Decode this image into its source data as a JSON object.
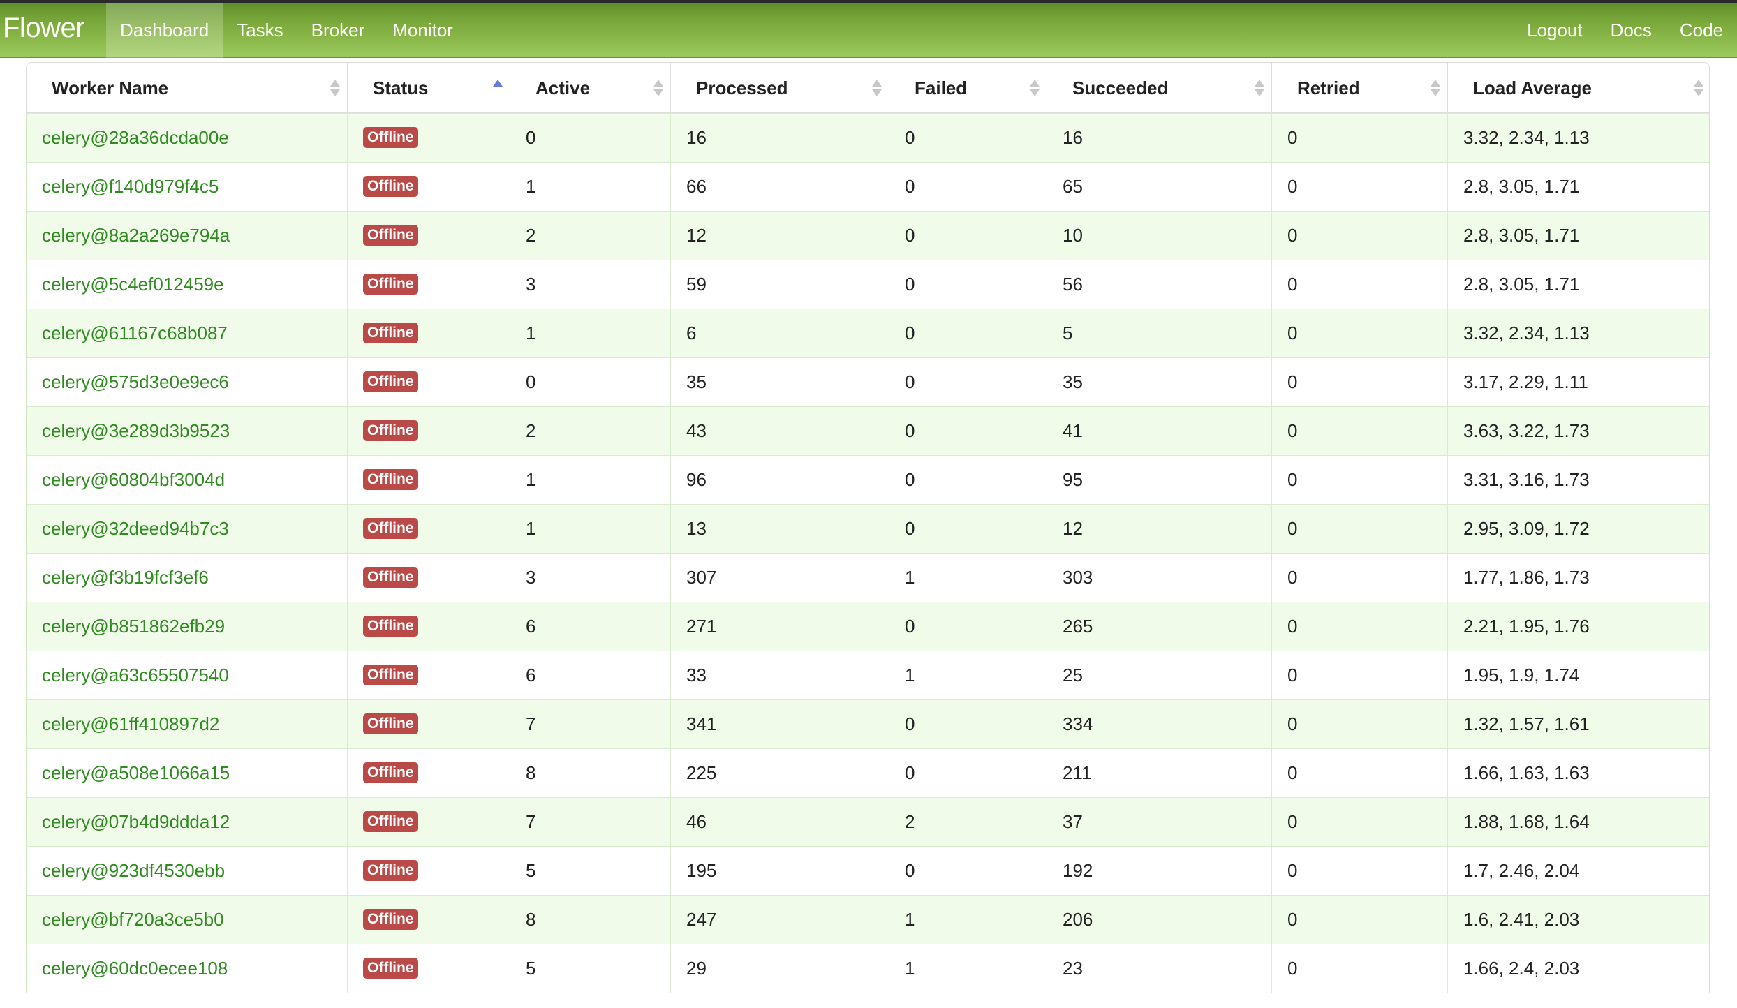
{
  "navbar": {
    "brand": "Flower",
    "left_items": [
      "Dashboard",
      "Tasks",
      "Broker",
      "Monitor"
    ],
    "right_items": [
      "Logout",
      "Docs",
      "Code"
    ],
    "active": "Dashboard"
  },
  "table": {
    "columns": [
      {
        "label": "Worker Name",
        "sort": "none"
      },
      {
        "label": "Status",
        "sort": "asc"
      },
      {
        "label": "Active",
        "sort": "none"
      },
      {
        "label": "Processed",
        "sort": "none"
      },
      {
        "label": "Failed",
        "sort": "none"
      },
      {
        "label": "Succeeded",
        "sort": "none"
      },
      {
        "label": "Retried",
        "sort": "none"
      },
      {
        "label": "Load Average",
        "sort": "none"
      }
    ],
    "rows": [
      [
        "celery@28a36dcda00e",
        "Offline",
        "0",
        "16",
        "0",
        "16",
        "0",
        "3.32, 2.34, 1.13"
      ],
      [
        "celery@f140d979f4c5",
        "Offline",
        "1",
        "66",
        "0",
        "65",
        "0",
        "2.8, 3.05, 1.71"
      ],
      [
        "celery@8a2a269e794a",
        "Offline",
        "2",
        "12",
        "0",
        "10",
        "0",
        "2.8, 3.05, 1.71"
      ],
      [
        "celery@5c4ef012459e",
        "Offline",
        "3",
        "59",
        "0",
        "56",
        "0",
        "2.8, 3.05, 1.71"
      ],
      [
        "celery@61167c68b087",
        "Offline",
        "1",
        "6",
        "0",
        "5",
        "0",
        "3.32, 2.34, 1.13"
      ],
      [
        "celery@575d3e0e9ec6",
        "Offline",
        "0",
        "35",
        "0",
        "35",
        "0",
        "3.17, 2.29, 1.11"
      ],
      [
        "celery@3e289d3b9523",
        "Offline",
        "2",
        "43",
        "0",
        "41",
        "0",
        "3.63, 3.22, 1.73"
      ],
      [
        "celery@60804bf3004d",
        "Offline",
        "1",
        "96",
        "0",
        "95",
        "0",
        "3.31, 3.16, 1.73"
      ],
      [
        "celery@32deed94b7c3",
        "Offline",
        "1",
        "13",
        "0",
        "12",
        "0",
        "2.95, 3.09, 1.72"
      ],
      [
        "celery@f3b19fcf3ef6",
        "Offline",
        "3",
        "307",
        "1",
        "303",
        "0",
        "1.77, 1.86, 1.73"
      ],
      [
        "celery@b851862efb29",
        "Offline",
        "6",
        "271",
        "0",
        "265",
        "0",
        "2.21, 1.95, 1.76"
      ],
      [
        "celery@a63c65507540",
        "Offline",
        "6",
        "33",
        "1",
        "25",
        "0",
        "1.95, 1.9, 1.74"
      ],
      [
        "celery@61ff410897d2",
        "Offline",
        "7",
        "341",
        "0",
        "334",
        "0",
        "1.32, 1.57, 1.61"
      ],
      [
        "celery@a508e1066a15",
        "Offline",
        "8",
        "225",
        "0",
        "211",
        "0",
        "1.66, 1.63, 1.63"
      ],
      [
        "celery@07b4d9ddda12",
        "Offline",
        "7",
        "46",
        "2",
        "37",
        "0",
        "1.88, 1.68, 1.64"
      ],
      [
        "celery@923df4530ebb",
        "Offline",
        "5",
        "195",
        "0",
        "192",
        "0",
        "1.7, 2.46, 2.04"
      ],
      [
        "celery@bf720a3ce5b0",
        "Offline",
        "8",
        "247",
        "1",
        "206",
        "0",
        "1.6, 2.41, 2.03"
      ],
      [
        "celery@60dc0ecee108",
        "Offline",
        "5",
        "29",
        "1",
        "23",
        "0",
        "1.66, 2.4, 2.03"
      ]
    ]
  },
  "colors": {
    "nav_gradient_top": "#5f8f2a",
    "nav_gradient_bottom": "#9cc95c",
    "link_green": "#2e8b1e",
    "offline_badge": "#b94a48",
    "row_stripe": "#f1fbea",
    "sort_active": "#6a7ad8"
  }
}
